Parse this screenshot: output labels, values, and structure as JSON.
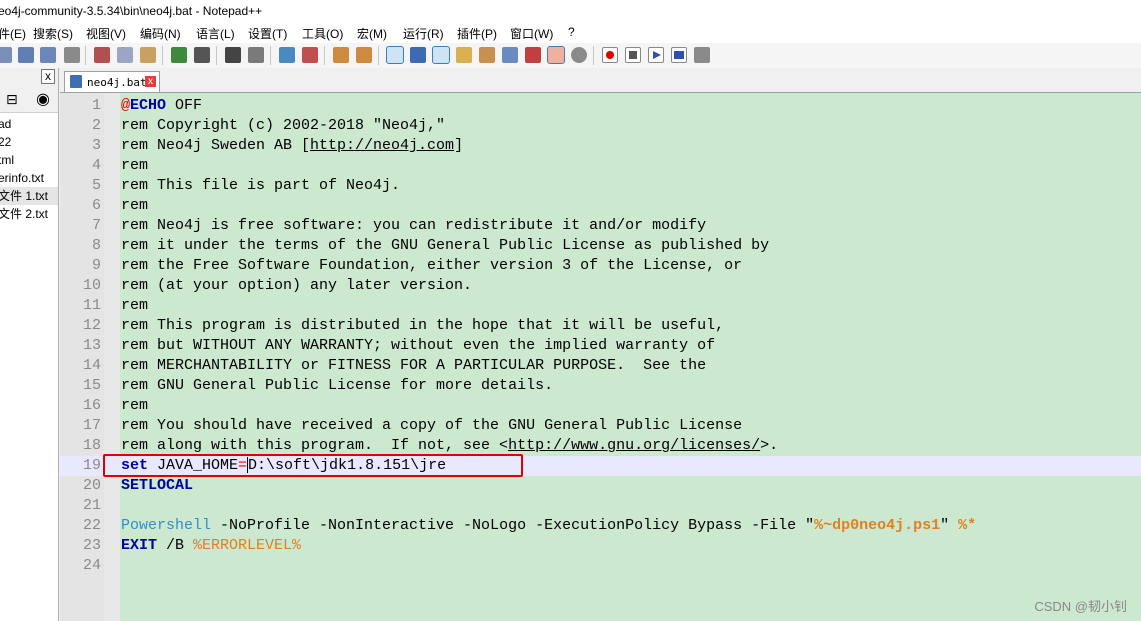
{
  "window": {
    "title": "eo4j-community-3.5.34\\bin\\neo4j.bat - Notepad++"
  },
  "menu": [
    {
      "name": "menu-file",
      "label": "件(E)"
    },
    {
      "name": "menu-search",
      "label": "搜索(S)"
    },
    {
      "name": "menu-view",
      "label": "视图(V)"
    },
    {
      "name": "menu-edit",
      "label": "编码(N)"
    },
    {
      "name": "menu-language",
      "label": "语言(L)"
    },
    {
      "name": "menu-settings",
      "label": "设置(T)"
    },
    {
      "name": "menu-tools",
      "label": "工具(O)"
    },
    {
      "name": "menu-macro",
      "label": "宏(M)"
    },
    {
      "name": "menu-run",
      "label": "运行(R)"
    },
    {
      "name": "menu-plugins",
      "label": "插件(P)"
    },
    {
      "name": "menu-window",
      "label": "窗口(W)"
    },
    {
      "name": "menu-help",
      "label": "?"
    }
  ],
  "toolbar_icons": [
    "save-icon",
    "save-all-icon",
    "close-icon",
    "close-all-icon",
    "print-icon",
    "cut-icon",
    "copy-icon",
    "paste-icon",
    "undo-icon",
    "redo-icon",
    "find-icon",
    "zoom-in-icon",
    "zoom-out-icon",
    "sync-vertical-icon",
    "sync-horizontal-icon",
    "word-wrap-icon",
    "show-all-chars-icon",
    "indent-guide-icon",
    "doc-map-icon",
    "function-list-icon",
    "folder-workspace-icon",
    "monitoring-icon",
    "doc-switcher-icon",
    "show-symbol-icon",
    "preview-icon",
    "record-macro-icon",
    "stop-record-icon",
    "play-macro-icon",
    "run-macro-multiple-icon",
    "save-macro-icon"
  ],
  "side_panel": {
    "close_label": "x",
    "files": [
      "ad",
      "22",
      "tml",
      "erinfo.txt",
      "文件 1.txt",
      "文件 2.txt"
    ]
  },
  "tab": {
    "label": "neo4j.bat",
    "close": "x"
  },
  "editor": {
    "line_numbers": [
      "1",
      "2",
      "3",
      "4",
      "5",
      "6",
      "7",
      "8",
      "9",
      "10",
      "11",
      "12",
      "13",
      "14",
      "15",
      "16",
      "17",
      "18",
      "19",
      "20",
      "21",
      "22",
      "23",
      "24"
    ],
    "l1": {
      "at": "@",
      "kw": "ECHO",
      "rest": " OFF"
    },
    "l2": "rem Copyright (c) 2002-2018 \"Neo4j,\"",
    "l3": {
      "pre": "rem Neo4j Sweden AB [",
      "url": "http://neo4j.com",
      "post": "]"
    },
    "l4": "rem",
    "l5": "rem This file is part of Neo4j.",
    "l6": "rem",
    "l7": "rem Neo4j is free software: you can redistribute it and/or modify",
    "l8": "rem it under the terms of the GNU General Public License as published by",
    "l9": "rem the Free Software Foundation, either version 3 of the License, or",
    "l10": "rem (at your option) any later version.",
    "l11": "rem",
    "l12": "rem This program is distributed in the hope that it will be useful,",
    "l13": "rem but WITHOUT ANY WARRANTY; without even the implied warranty of",
    "l14": "rem MERCHANTABILITY or FITNESS FOR A PARTICULAR PURPOSE.  See the",
    "l15": "rem GNU General Public License for more details.",
    "l16": "rem",
    "l17": "rem You should have received a copy of the GNU General Public License",
    "l18": {
      "pre": "rem along with this program.  If not, see <",
      "url": "http://www.gnu.org/licenses/",
      "post": ">."
    },
    "l19": {
      "kw": "set",
      "mid": " JAVA_HOME",
      "eq": "=",
      "value": "D:\\soft\\jdk1.8.151\\jre"
    },
    "l20": {
      "kw": "SETLOCAL"
    },
    "l22": {
      "ps": "Powershell",
      "args": " -NoProfile -NonInteractive -NoLogo -ExecutionPolicy Bypass -File \"",
      "script": "%~dp0neo4j.ps1",
      "quote": "\"",
      "star": " %*"
    },
    "l23": {
      "kw": "EXIT",
      "mid": " /B ",
      "var": "%ERRORLEVEL%"
    }
  },
  "watermark": "CSDN @韧小钊",
  "colors": {
    "editor_bg": "#cce8cf",
    "comment": "#008000",
    "keyword": "#0000a0",
    "highlight_box": "#e00000"
  }
}
